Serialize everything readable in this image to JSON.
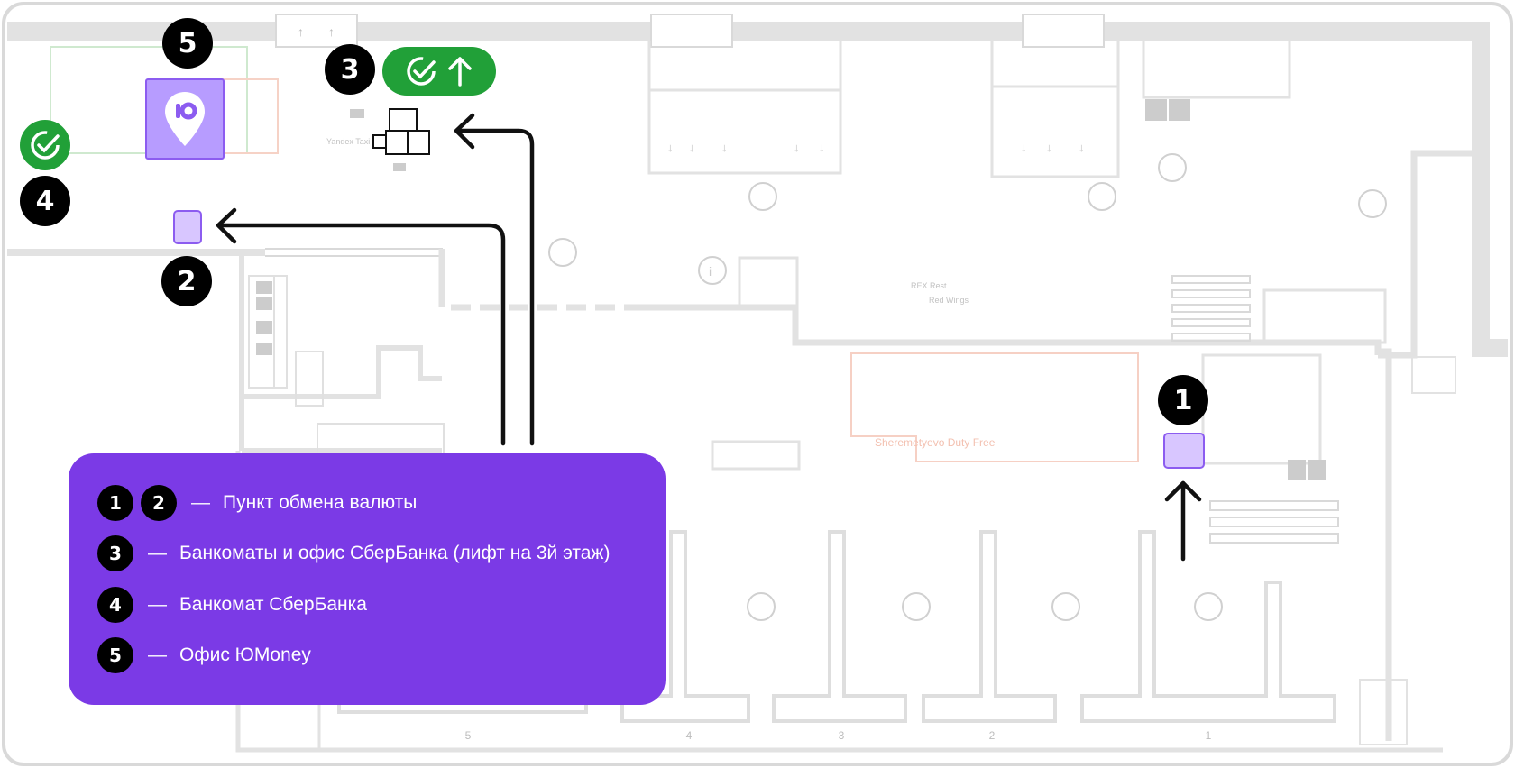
{
  "map": {
    "markers": [
      {
        "id": "1",
        "label": "1"
      },
      {
        "id": "2",
        "label": "2"
      },
      {
        "id": "3",
        "label": "3"
      },
      {
        "id": "4",
        "label": "4"
      },
      {
        "id": "5",
        "label": "5"
      }
    ],
    "floor_labels": {
      "duty_free": "Sheremetyevo Duty Free",
      "yandex": "Yandex Taxi",
      "rex": "REX Rest",
      "red_wings": "Red Wings"
    },
    "gates": [
      "5",
      "4",
      "3",
      "2",
      "1"
    ]
  },
  "legend": {
    "items": [
      {
        "numbers": [
          "1",
          "2"
        ],
        "dash": "—",
        "text": "Пункт обмена валюты"
      },
      {
        "numbers": [
          "3"
        ],
        "dash": "—",
        "text": "Банкоматы и офис СберБанка (лифт на 3й этаж)"
      },
      {
        "numbers": [
          "4"
        ],
        "dash": "—",
        "text": "Банкомат СберБанка"
      },
      {
        "numbers": [
          "5"
        ],
        "dash": "—",
        "text": "Офис ЮMoney"
      }
    ]
  },
  "colors": {
    "legend_bg": "#7b3ae6",
    "sber_green": "#21a038",
    "yoomoney_purple": "#b79cff",
    "exchange_fill": "#d8c6ff",
    "wall": "#e2e2e2"
  },
  "icons": [
    "sber-check-icon",
    "arrow-up-icon",
    "yoomoney-pin-icon",
    "cart-icon",
    "escalator-icon",
    "toilet-icon",
    "info-icon",
    "atm-icon"
  ]
}
